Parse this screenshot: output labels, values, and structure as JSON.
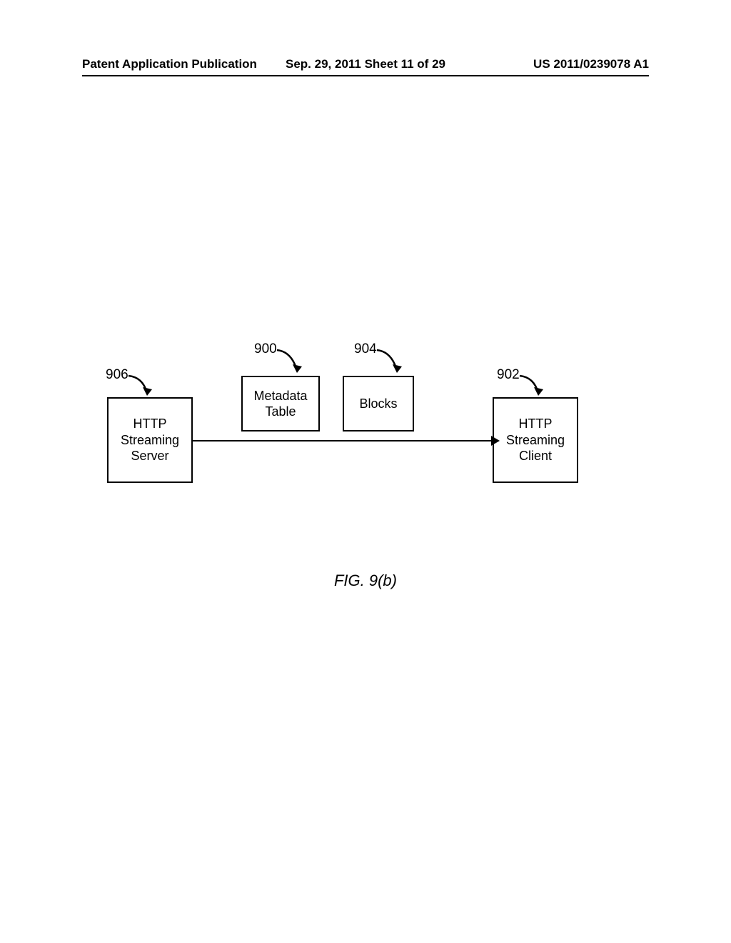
{
  "header": {
    "left": "Patent Application Publication",
    "center": "Sep. 29, 2011  Sheet 11 of 29",
    "right": "US 2011/0239078 A1"
  },
  "refs": {
    "r900": "900",
    "r902": "902",
    "r904": "904",
    "r906": "906"
  },
  "boxes": {
    "server": "HTTP\nStreaming\nServer",
    "metadata": "Metadata\nTable",
    "blocks": "Blocks",
    "client": "HTTP\nStreaming\nClient"
  },
  "figure_caption": "FIG. 9(b)",
  "chart_data": {
    "type": "diagram",
    "title": "FIG. 9(b)",
    "nodes": [
      {
        "id": "906",
        "label": "HTTP Streaming Server"
      },
      {
        "id": "900",
        "label": "Metadata Table"
      },
      {
        "id": "904",
        "label": "Blocks"
      },
      {
        "id": "902",
        "label": "HTTP Streaming Client"
      }
    ],
    "edges": [
      {
        "from": "906",
        "to": "902",
        "label": "",
        "via": [
          "900",
          "904"
        ]
      }
    ],
    "reference_numerals": {
      "900": "Metadata Table",
      "902": "HTTP Streaming Client",
      "904": "Blocks",
      "906": "HTTP Streaming Server"
    }
  }
}
